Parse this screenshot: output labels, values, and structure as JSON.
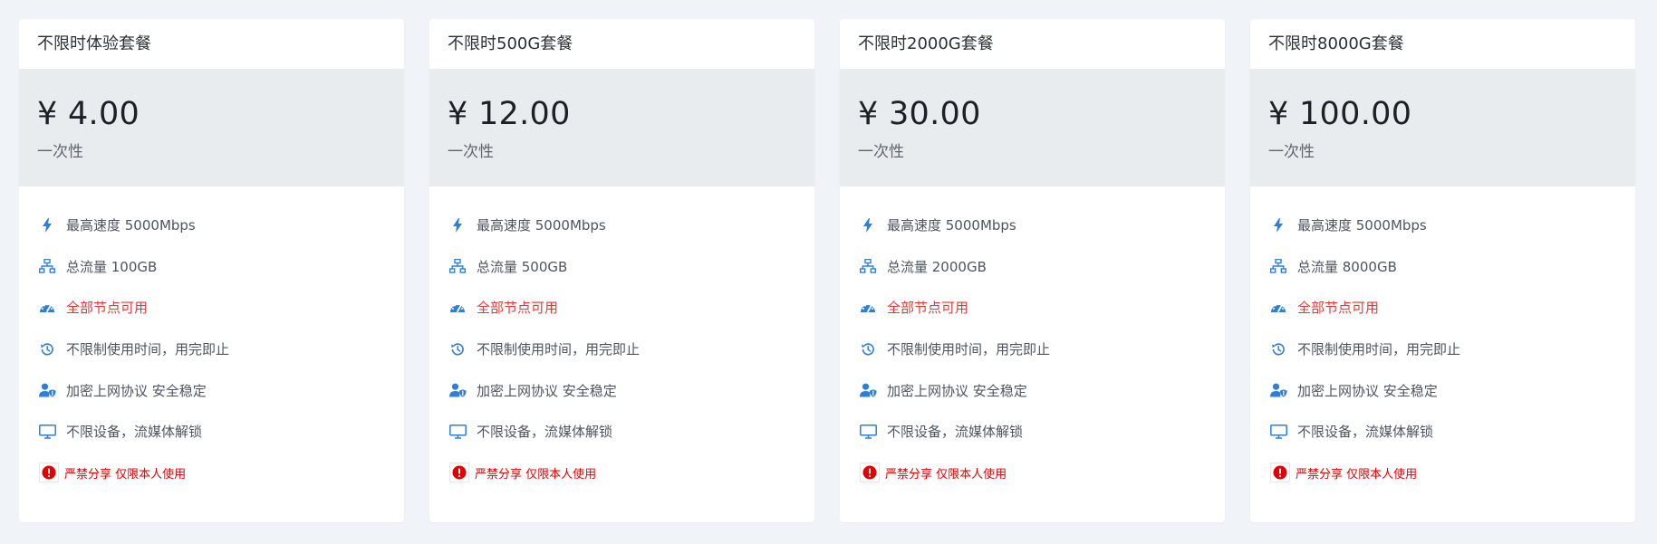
{
  "colors": {
    "page_bg": "#f0f3f8",
    "card_bg": "#ffffff",
    "price_bg": "#e9ecef",
    "icon_blue": "#2f7fd7",
    "red": "#e53935"
  },
  "plans": [
    {
      "title": "不限时体验套餐",
      "price": "¥ 4.00",
      "period": "一次性",
      "features": {
        "speed": "最高速度 5000Mbps",
        "traffic": "总流量 100GB",
        "nodes": "全部节点可用",
        "time": "不限制使用时间，用完即止",
        "security": "加密上网协议 安全稳定",
        "devices": "不限设备，流媒体解锁"
      },
      "warning": "严禁分享 仅限本人使用"
    },
    {
      "title": "不限时500G套餐",
      "price": "¥ 12.00",
      "period": "一次性",
      "features": {
        "speed": "最高速度 5000Mbps",
        "traffic": "总流量 500GB",
        "nodes": "全部节点可用",
        "time": "不限制使用时间，用完即止",
        "security": "加密上网协议 安全稳定",
        "devices": "不限设备，流媒体解锁"
      },
      "warning": "严禁分享 仅限本人使用"
    },
    {
      "title": "不限时2000G套餐",
      "price": "¥ 30.00",
      "period": "一次性",
      "features": {
        "speed": "最高速度 5000Mbps",
        "traffic": "总流量 2000GB",
        "nodes": "全部节点可用",
        "time": "不限制使用时间，用完即止",
        "security": "加密上网协议 安全稳定",
        "devices": "不限设备，流媒体解锁"
      },
      "warning": "严禁分享 仅限本人使用"
    },
    {
      "title": "不限时8000G套餐",
      "price": "¥ 100.00",
      "period": "一次性",
      "features": {
        "speed": "最高速度 5000Mbps",
        "traffic": "总流量 8000GB",
        "nodes": "全部节点可用",
        "time": "不限制使用时间，用完即止",
        "security": "加密上网协议 安全稳定",
        "devices": "不限设备，流媒体解锁"
      },
      "warning": "严禁分享 仅限本人使用"
    }
  ]
}
